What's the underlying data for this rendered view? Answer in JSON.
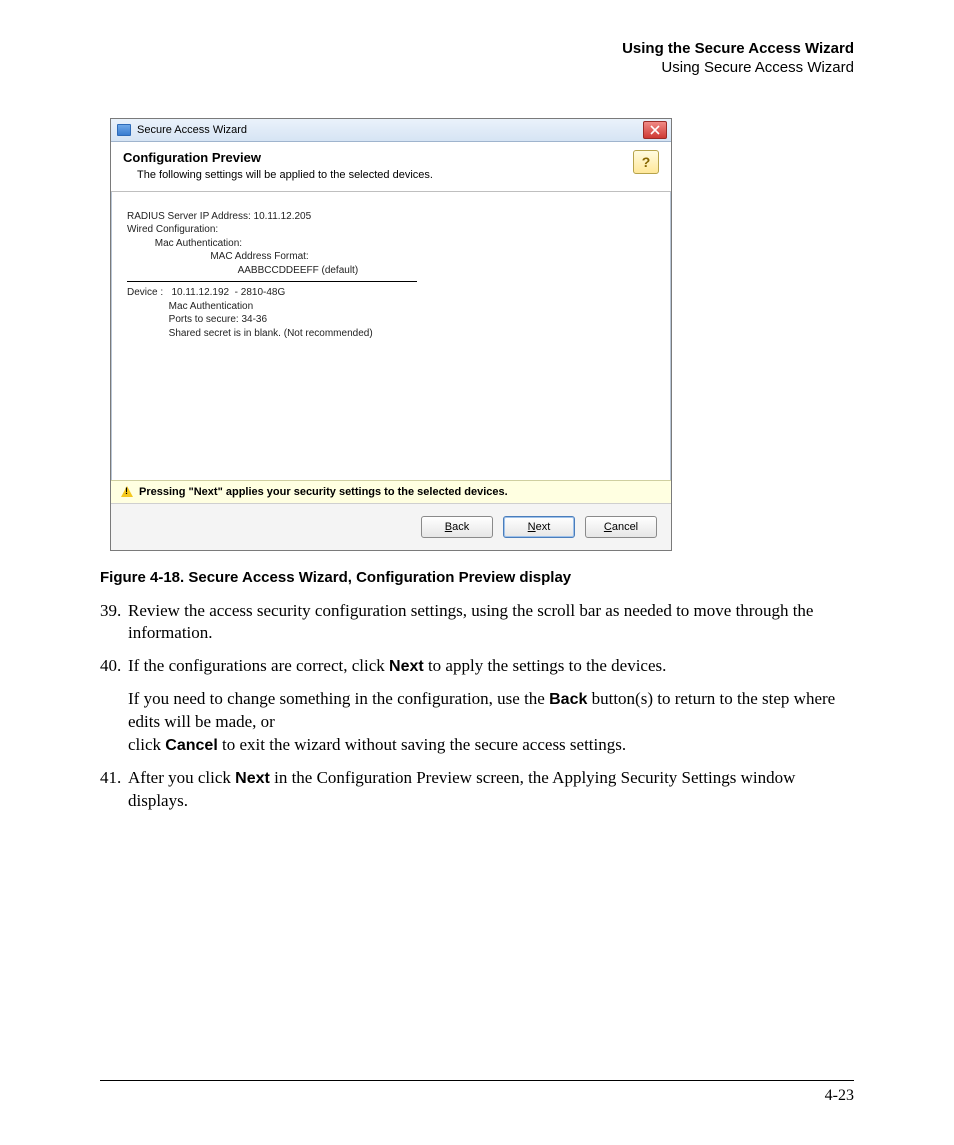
{
  "header": {
    "line1": "Using the Secure Access Wizard",
    "line2": "Using Secure Access Wizard"
  },
  "dialog": {
    "title": "Secure Access Wizard",
    "heading": "Configuration Preview",
    "subheading": "The following settings will be applied to the selected devices.",
    "help_label": "?",
    "config": {
      "radius_line": "RADIUS Server IP Address: 10.11.12.205",
      "wired_line": "Wired Configuration:",
      "mac_auth_line": "          Mac Authentication:",
      "mac_fmt_line": "                              MAC Address Format:",
      "mac_fmt_value": "                                        AABBCCDDEEFF (default)",
      "device_line": "Device :   10.11.12.192  - 2810-48G",
      "dev_mac_line": "               Mac Authentication",
      "dev_ports_line": "               Ports to secure: 34-36",
      "dev_secret_line": "               Shared secret is in blank. (Not recommended)"
    },
    "warning": "Pressing \"Next\" applies your security settings to the selected devices.",
    "buttons": {
      "back": "Back",
      "next": "Next",
      "cancel": "Cancel"
    }
  },
  "figure_caption": "Figure 4-18. Secure Access Wizard, Configuration Preview display",
  "steps": {
    "s39_num": "39.",
    "s39_text": "Review the access security configuration settings, using the scroll bar as needed to move through the information.",
    "s40_num": "40.",
    "s40_a_pre": "If the configurations are correct, click ",
    "s40_a_bold": "Next",
    "s40_a_post": " to apply the settings to the devices.",
    "s40_b_pre": "If you need to change something in the configuration, use the ",
    "s40_b_bold": "Back",
    "s40_b_post": " button(s) to return to the step where edits will be made, or",
    "s40_c_pre": "click ",
    "s40_c_bold": "Cancel",
    "s40_c_post": " to exit the wizard without saving the secure access settings.",
    "s41_num": "41.",
    "s41_pre": "After you click ",
    "s41_bold": "Next",
    "s41_post": " in the Configuration Preview screen, the Applying Security Settings window displays."
  },
  "page_number": "4-23"
}
